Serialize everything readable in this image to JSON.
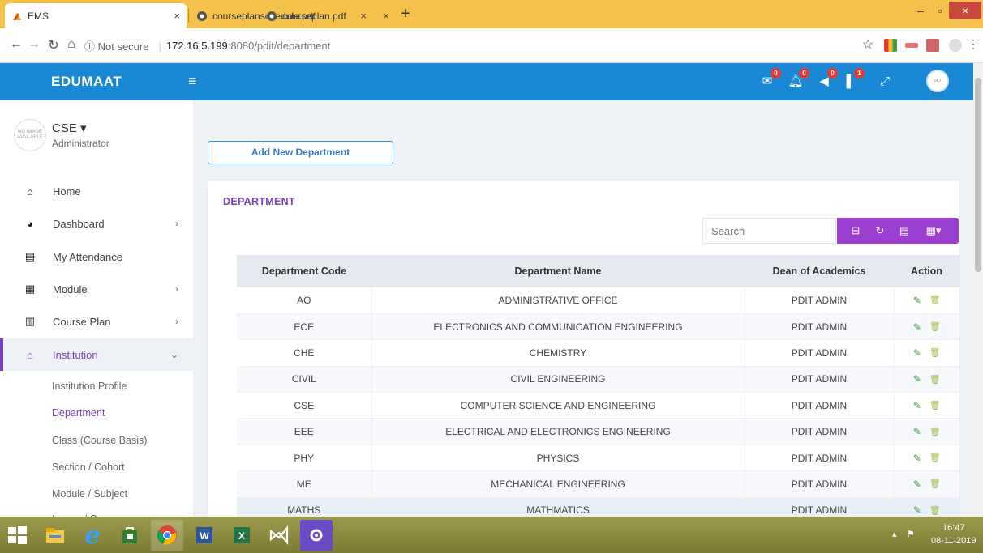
{
  "browser": {
    "tabs": [
      {
        "title": "EMS",
        "icon": "ems-favicon",
        "active": true
      },
      {
        "title": "courseplanschedule.pdf",
        "icon": "pdf-favicon",
        "active": false
      },
      {
        "title": "courseplan.pdf",
        "icon": "pdf-favicon",
        "active": false
      }
    ],
    "close_glyph": "×",
    "new_tab": "+",
    "url_security": "ⓘ Not secure",
    "url_host": "172.16.5.199",
    "url_rest": ":8080/pdit/department"
  },
  "header": {
    "brand": "EDUMAAT",
    "badges": {
      "messages": "0",
      "notifications": "0",
      "announcements": "0",
      "alerts": "1"
    },
    "avatar_text": "NO IMAGE AVAILABLE"
  },
  "sidebar": {
    "avatar_text": "NO IMAGE AVAILABLE",
    "user_name": "CSE ▾",
    "user_role": "Administrator",
    "items": [
      {
        "label": "Home",
        "icon": "home-icon",
        "glyph": "⌂",
        "arrow": ""
      },
      {
        "label": "Dashboard",
        "icon": "dashboard-icon",
        "glyph": "◕",
        "arrow": "›"
      },
      {
        "label": "My Attendance",
        "icon": "attendance-icon",
        "glyph": "▤",
        "arrow": ""
      },
      {
        "label": "Module",
        "icon": "module-icon",
        "glyph": "▦",
        "arrow": "›"
      },
      {
        "label": "Course Plan",
        "icon": "course-plan-icon",
        "glyph": "▥",
        "arrow": "›"
      },
      {
        "label": "Institution",
        "icon": "institution-icon",
        "glyph": "⌂",
        "arrow": "⌄"
      }
    ],
    "subitems": [
      "Institution Profile",
      "Department",
      "Class (Course Basis)",
      "Section / Cohort",
      "Module / Subject",
      "House / Group"
    ]
  },
  "main": {
    "add_button": "Add New Department",
    "card_title": "DEPARTMENT",
    "search_placeholder": "Search",
    "table": {
      "headers": [
        "Department Code",
        "Department Name",
        "Dean of Academics",
        "Action"
      ],
      "rows": [
        [
          "AO",
          "ADMINISTRATIVE OFFICE",
          "PDIT ADMIN"
        ],
        [
          "ECE",
          "ELECTRONICS AND COMMUNICATION ENGINEERING",
          "PDIT ADMIN"
        ],
        [
          "CHE",
          "CHEMISTRY",
          "PDIT ADMIN"
        ],
        [
          "CIVIL",
          "CIVIL ENGINEERING",
          "PDIT ADMIN"
        ],
        [
          "CSE",
          "COMPUTER SCIENCE AND ENGINEERING",
          "PDIT ADMIN"
        ],
        [
          "EEE",
          "ELECTRICAL AND ELECTRONICS ENGINEERING",
          "PDIT ADMIN"
        ],
        [
          "PHY",
          "PHYSICS",
          "PDIT ADMIN"
        ],
        [
          "ME",
          "MECHANICAL ENGINEERING",
          "PDIT ADMIN"
        ],
        [
          "MATHS",
          "MATHMATICS",
          "PDIT ADMIN"
        ]
      ]
    }
  },
  "taskbar": {
    "time": "16:47",
    "date": "08-11-2019"
  },
  "colors": {
    "header_blue": "#1a88d4",
    "accent_purple": "#7b3fbf",
    "tool_purple": "#9b3fd1",
    "tabstrip": "#f4c24a"
  }
}
